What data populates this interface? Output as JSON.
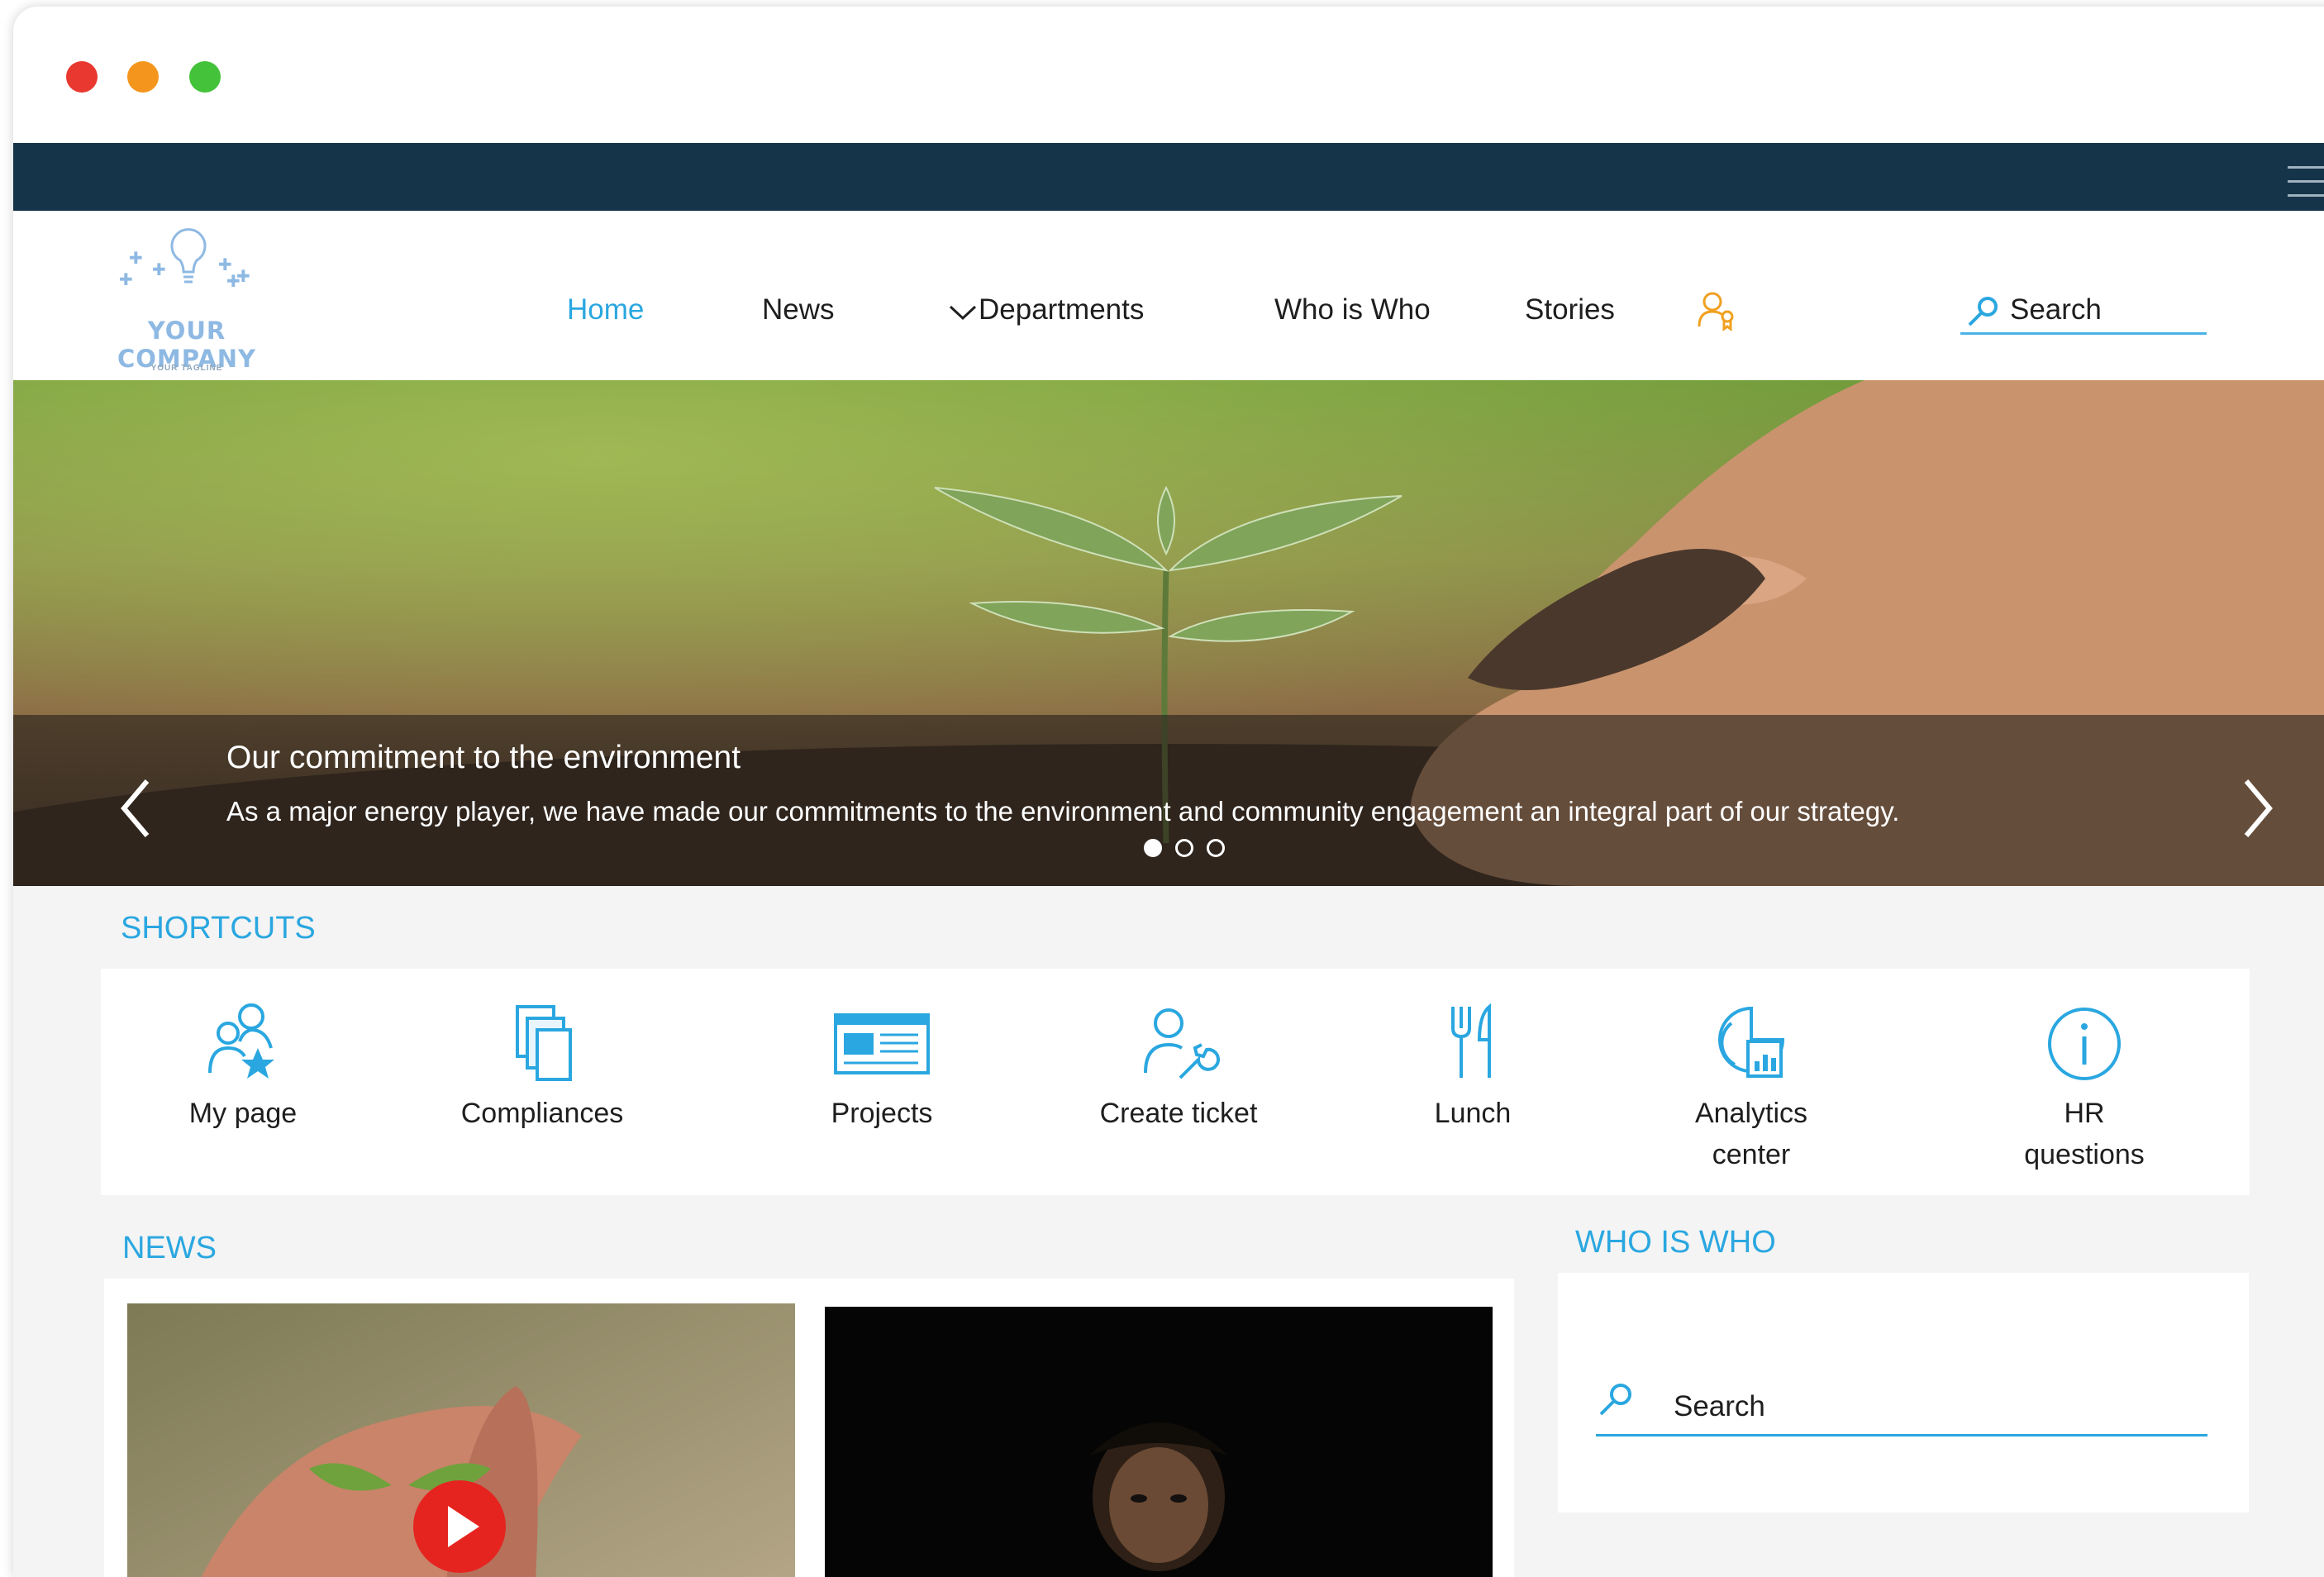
{
  "brand": {
    "company_name": "YOUR COMPANY",
    "tagline": "YOUR TAGLINE",
    "accent_color": "#2aa7e0",
    "topbar_color": "#15344a"
  },
  "nav": {
    "items": [
      {
        "label": "Home",
        "active": true
      },
      {
        "label": "News",
        "active": false
      },
      {
        "label": "Departments",
        "active": false,
        "has_dropdown": true
      },
      {
        "label": "Who is Who",
        "active": false
      },
      {
        "label": "Stories",
        "active": false
      }
    ],
    "badge_icon": "user-award-icon",
    "search_placeholder": "Search"
  },
  "hero": {
    "title": "Our commitment to the environment",
    "text": "As a major energy player, we have made our commitments to the environment and community engagement an integral part of our strategy.",
    "slide_count": 3,
    "active_slide": 1
  },
  "shortcuts": {
    "title": "SHORTCUTS",
    "items": [
      {
        "label": "My page",
        "icon": "users-star-icon"
      },
      {
        "label": "Compliances",
        "icon": "documents-icon"
      },
      {
        "label": "Projects",
        "icon": "projects-window-icon"
      },
      {
        "label": "Create ticket",
        "icon": "user-wrench-icon"
      },
      {
        "label": "Lunch",
        "icon": "fork-knife-icon"
      },
      {
        "label": "Analytics center",
        "icon": "analytics-icon"
      },
      {
        "label": "HR questions",
        "icon": "info-icon"
      }
    ]
  },
  "news": {
    "title": "NEWS"
  },
  "who_is_who": {
    "title": "WHO IS WHO",
    "search_placeholder": "Search"
  }
}
